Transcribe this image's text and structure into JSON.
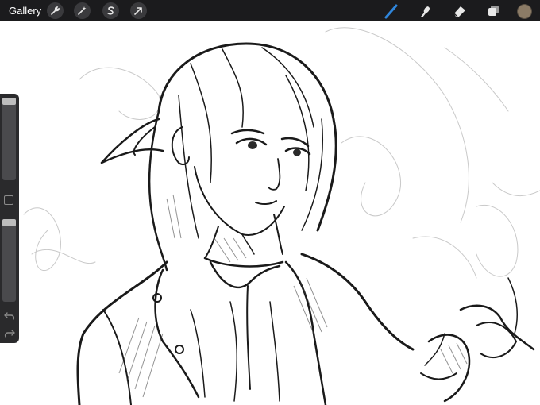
{
  "topbar": {
    "gallery_label": "Gallery",
    "left_tools": [
      {
        "name": "actions-wrench-icon"
      },
      {
        "name": "adjustments-magic-wand-icon"
      },
      {
        "name": "selection-s-icon"
      },
      {
        "name": "transform-arrow-icon"
      }
    ],
    "right_tools": [
      {
        "name": "brush-icon",
        "active": true
      },
      {
        "name": "smudge-icon"
      },
      {
        "name": "eraser-icon"
      },
      {
        "name": "layers-icon"
      }
    ],
    "color_swatch": "#8b7b66"
  },
  "sidebar": {
    "brush_size_level": 0.0,
    "brush_opacity_level": 0.0
  },
  "colors": {
    "topbar_bg": "#1b1b1d",
    "active_tool": "#2f86dc",
    "canvas_bg": "#ffffff",
    "ink": "#1a1a1a"
  }
}
